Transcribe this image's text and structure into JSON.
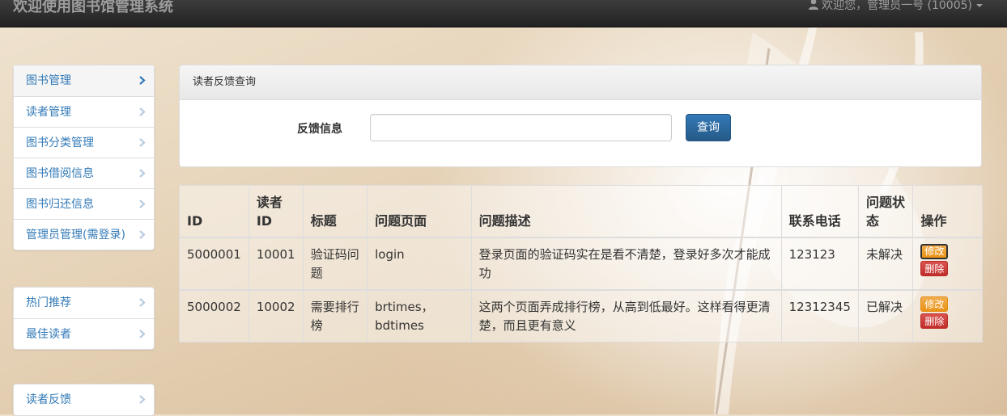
{
  "navbar": {
    "brand": "欢迎使用图书馆管理系统",
    "user_greeting": "欢迎您，管理员一号 (10005)"
  },
  "sidebar": {
    "group1": [
      {
        "label": "图书管理"
      },
      {
        "label": "读者管理"
      },
      {
        "label": "图书分类管理"
      },
      {
        "label": "图书借阅信息"
      },
      {
        "label": "图书归还信息"
      },
      {
        "label": "管理员管理(需登录)"
      }
    ],
    "group2": [
      {
        "label": "热门推荐"
      },
      {
        "label": "最佳读者"
      }
    ],
    "group3": [
      {
        "label": "读者反馈"
      }
    ]
  },
  "panel": {
    "heading": "读者反馈查询",
    "field_label": "反馈信息",
    "field_value": "",
    "query_button": "查询"
  },
  "table": {
    "headers": [
      "ID",
      "读者ID",
      "标题",
      "问题页面",
      "问题描述",
      "联系电话",
      "问题状态",
      "操作"
    ],
    "rows": [
      {
        "id": "5000001",
        "reader_id": "10001",
        "title": "验证码问题",
        "page": "login",
        "description": "登录页面的验证码实在是看不清楚，登录好多次才能成功",
        "phone": "123123",
        "status": "未解决",
        "edit": "修改",
        "delete": "删除"
      },
      {
        "id": "5000002",
        "reader_id": "10002",
        "title": "需要排行榜",
        "page": "brtimes，bdtimes",
        "description": "这两个页面弄成排行榜，从高到低最好。这样看得更清楚，而且更有意义",
        "phone": "12312345",
        "status": "已解决",
        "edit": "修改",
        "delete": "删除"
      }
    ]
  },
  "colors": {
    "navbar": "#222222",
    "link": "#337ab7",
    "primary": "#337ab7",
    "warning": "#f0ad4e",
    "danger": "#d9534f"
  }
}
